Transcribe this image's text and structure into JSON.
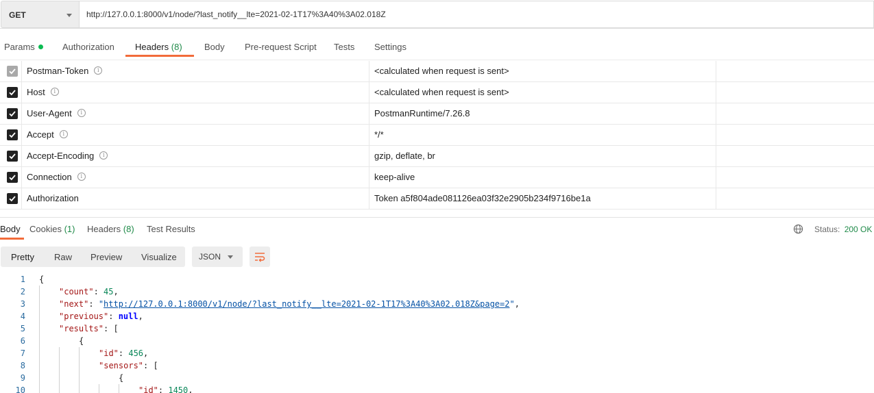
{
  "request": {
    "method": "GET",
    "url": "http://127.0.0.1:8000/v1/node/?last_notify__lte=2021-02-1T17%3A40%3A02.018Z"
  },
  "request_tabs": {
    "params": "Params",
    "authorization": "Authorization",
    "headers": "Headers",
    "headers_count": "(8)",
    "body": "Body",
    "prerequest": "Pre-request Script",
    "tests": "Tests",
    "settings": "Settings"
  },
  "headers": [
    {
      "key": "Postman-Token",
      "value": "<calculated when request is sent>",
      "checked": true,
      "disabled": true,
      "info": true
    },
    {
      "key": "Host",
      "value": "<calculated when request is sent>",
      "checked": true,
      "disabled": false,
      "info": true
    },
    {
      "key": "User-Agent",
      "value": "PostmanRuntime/7.26.8",
      "checked": true,
      "disabled": false,
      "info": true
    },
    {
      "key": "Accept",
      "value": "*/*",
      "checked": true,
      "disabled": false,
      "info": true
    },
    {
      "key": "Accept-Encoding",
      "value": "gzip, deflate, br",
      "checked": true,
      "disabled": false,
      "info": true
    },
    {
      "key": "Connection",
      "value": "keep-alive",
      "checked": true,
      "disabled": false,
      "info": true
    },
    {
      "key": "Authorization",
      "value": "Token a5f804ade081126ea03f32e2905b234f9716be1a",
      "checked": true,
      "disabled": false,
      "info": false
    }
  ],
  "response_tabs": {
    "body": "Body",
    "cookies": "Cookies",
    "cookies_count": "(1)",
    "headers": "Headers",
    "headers_count": "(8)",
    "test_results": "Test Results"
  },
  "status": {
    "label": "Status:",
    "value": "200 OK"
  },
  "view_modes": {
    "pretty": "Pretty",
    "raw": "Raw",
    "preview": "Preview",
    "visualize": "Visualize"
  },
  "format": "JSON",
  "code_lines": [
    {
      "n": "1",
      "key": "",
      "val": "",
      "open": "{"
    },
    {
      "n": "2",
      "key": "\"count\"",
      "val": "45",
      "type": "num"
    },
    {
      "n": "3",
      "key": "\"next\"",
      "val": "http://127.0.0.1:8000/v1/node/?last_notify__lte=2021-02-1T17%3A40%3A02.018Z&page=2",
      "type": "link"
    },
    {
      "n": "4",
      "key": "\"previous\"",
      "val": "null",
      "type": "kw"
    },
    {
      "n": "5",
      "key": "\"results\"",
      "val": "[",
      "type": "open"
    },
    {
      "n": "6",
      "key": "",
      "val": "",
      "open": "{"
    },
    {
      "n": "7",
      "key": "\"id\"",
      "val": "456",
      "type": "num"
    },
    {
      "n": "8",
      "key": "\"sensors\"",
      "val": "[",
      "type": "open"
    },
    {
      "n": "9",
      "key": "",
      "val": "",
      "open": "{"
    },
    {
      "n": "10",
      "key": "\"id\"",
      "val": "1450",
      "type": "num"
    }
  ],
  "colors": {
    "accent": "#f26b3a",
    "success": "#1f8a49",
    "dot": "#0cbb52"
  }
}
